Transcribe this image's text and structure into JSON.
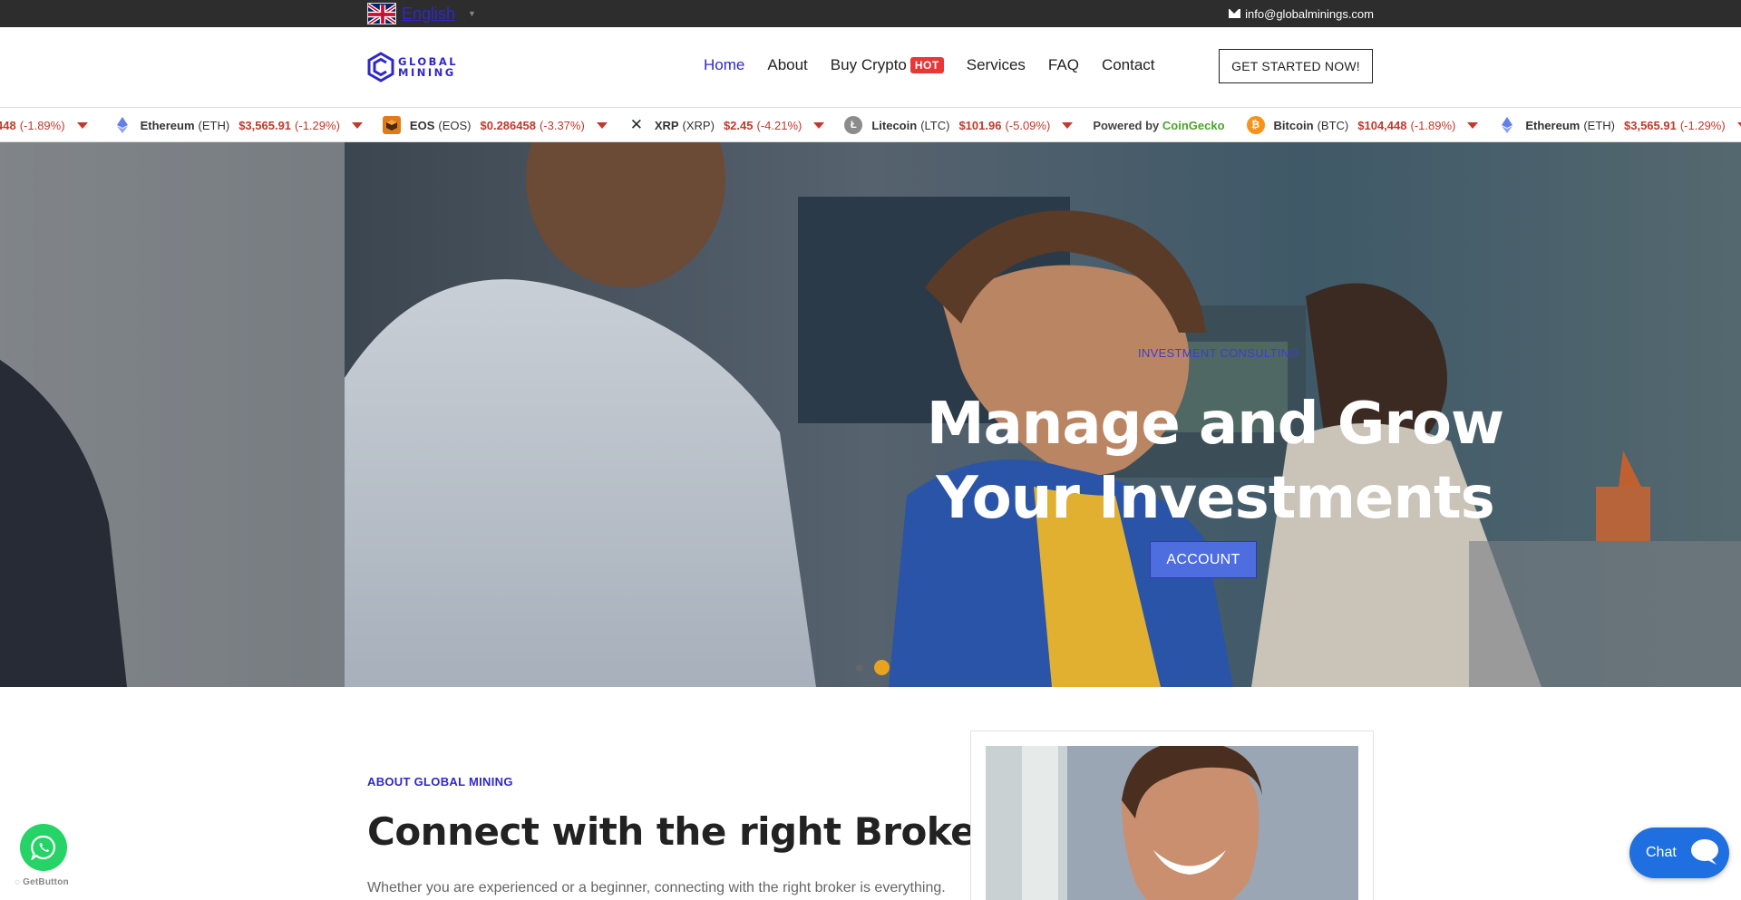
{
  "topbar": {
    "language": "English",
    "email": "info@globalminings.com"
  },
  "header": {
    "logo_line1": "GLOBAL",
    "logo_line2": "MINING",
    "nav": [
      {
        "label": "Home",
        "active": true
      },
      {
        "label": "About",
        "active": false
      },
      {
        "label": "Buy Crypto",
        "badge": "HOT",
        "active": false
      },
      {
        "label": "Services",
        "active": false
      },
      {
        "label": "FAQ",
        "active": false
      },
      {
        "label": "Contact",
        "active": false
      }
    ],
    "cta": "GET STARTED NOW!"
  },
  "ticker": {
    "lead_fragment": {
      "price": "448",
      "change": "(-1.89%)"
    },
    "items": [
      {
        "name": "Ethereum",
        "symbol": "(ETH)",
        "price": "$3,565.91",
        "change": "(-1.29%)",
        "icon": "ethereum-icon",
        "color": "#627eea"
      },
      {
        "name": "EOS",
        "symbol": "(EOS)",
        "price": "$0.286458",
        "change": "(-3.37%)",
        "icon": "eos-icon",
        "color": "#e07b1a"
      },
      {
        "name": "XRP",
        "symbol": "(XRP)",
        "price": "$2.45",
        "change": "(-4.21%)",
        "icon": "xrp-icon",
        "color": "#23292f"
      },
      {
        "name": "Litecoin",
        "symbol": "(LTC)",
        "price": "$101.96",
        "change": "(-5.09%)",
        "icon": "litecoin-icon",
        "color": "#8c8c8c"
      }
    ],
    "powered_by": "Powered by",
    "powered_brand": "CoinGecko",
    "items_repeat": [
      {
        "name": "Bitcoin",
        "symbol": "(BTC)",
        "price": "$104,448",
        "change": "(-1.89%)",
        "icon": "bitcoin-icon",
        "color": "#f7931a"
      },
      {
        "name": "Ethereum",
        "symbol": "(ETH)",
        "price": "$3,565.91",
        "change": "(-1.29%)",
        "icon": "ethereum-icon",
        "color": "#627eea"
      }
    ]
  },
  "hero": {
    "subtitle": "INVESTMENT CONSULTING",
    "title_line1": "Manage and Grow",
    "title_line2": "Your Investments",
    "button": "ACCOUNT",
    "slides": 2,
    "active_slide": 2
  },
  "about": {
    "kicker": "ABOUT GLOBAL MINING",
    "title": "Connect with the right Broker.",
    "text": "Whether you are experienced or a beginner, connecting with the right broker is everything."
  },
  "floating": {
    "getbutton": "GetButton",
    "chat_label": "Chat"
  },
  "colors": {
    "accent": "#2f28c9",
    "hot_badge": "#e83737",
    "negative": "#c0392b",
    "slider_active": "#e8a320",
    "whatsapp": "#25d366",
    "chat": "#1f6fe0"
  }
}
